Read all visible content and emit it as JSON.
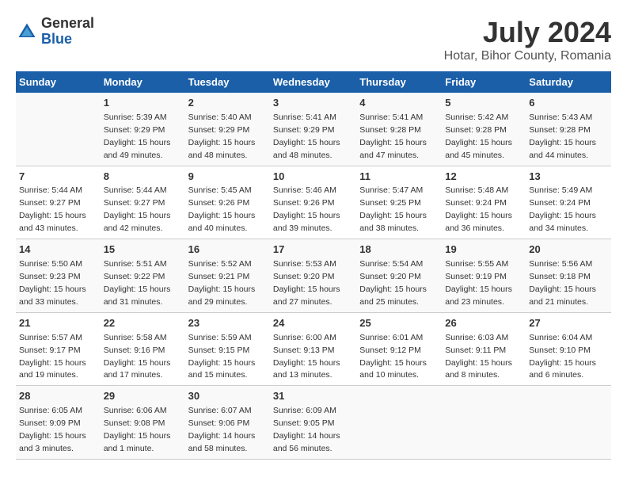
{
  "header": {
    "logo_general": "General",
    "logo_blue": "Blue",
    "title": "July 2024",
    "subtitle": "Hotar, Bihor County, Romania"
  },
  "calendar": {
    "headers": [
      "Sunday",
      "Monday",
      "Tuesday",
      "Wednesday",
      "Thursday",
      "Friday",
      "Saturday"
    ],
    "weeks": [
      [
        {
          "day": "",
          "info": ""
        },
        {
          "day": "1",
          "info": "Sunrise: 5:39 AM\nSunset: 9:29 PM\nDaylight: 15 hours\nand 49 minutes."
        },
        {
          "day": "2",
          "info": "Sunrise: 5:40 AM\nSunset: 9:29 PM\nDaylight: 15 hours\nand 48 minutes."
        },
        {
          "day": "3",
          "info": "Sunrise: 5:41 AM\nSunset: 9:29 PM\nDaylight: 15 hours\nand 48 minutes."
        },
        {
          "day": "4",
          "info": "Sunrise: 5:41 AM\nSunset: 9:28 PM\nDaylight: 15 hours\nand 47 minutes."
        },
        {
          "day": "5",
          "info": "Sunrise: 5:42 AM\nSunset: 9:28 PM\nDaylight: 15 hours\nand 45 minutes."
        },
        {
          "day": "6",
          "info": "Sunrise: 5:43 AM\nSunset: 9:28 PM\nDaylight: 15 hours\nand 44 minutes."
        }
      ],
      [
        {
          "day": "7",
          "info": "Sunrise: 5:44 AM\nSunset: 9:27 PM\nDaylight: 15 hours\nand 43 minutes."
        },
        {
          "day": "8",
          "info": "Sunrise: 5:44 AM\nSunset: 9:27 PM\nDaylight: 15 hours\nand 42 minutes."
        },
        {
          "day": "9",
          "info": "Sunrise: 5:45 AM\nSunset: 9:26 PM\nDaylight: 15 hours\nand 40 minutes."
        },
        {
          "day": "10",
          "info": "Sunrise: 5:46 AM\nSunset: 9:26 PM\nDaylight: 15 hours\nand 39 minutes."
        },
        {
          "day": "11",
          "info": "Sunrise: 5:47 AM\nSunset: 9:25 PM\nDaylight: 15 hours\nand 38 minutes."
        },
        {
          "day": "12",
          "info": "Sunrise: 5:48 AM\nSunset: 9:24 PM\nDaylight: 15 hours\nand 36 minutes."
        },
        {
          "day": "13",
          "info": "Sunrise: 5:49 AM\nSunset: 9:24 PM\nDaylight: 15 hours\nand 34 minutes."
        }
      ],
      [
        {
          "day": "14",
          "info": "Sunrise: 5:50 AM\nSunset: 9:23 PM\nDaylight: 15 hours\nand 33 minutes."
        },
        {
          "day": "15",
          "info": "Sunrise: 5:51 AM\nSunset: 9:22 PM\nDaylight: 15 hours\nand 31 minutes."
        },
        {
          "day": "16",
          "info": "Sunrise: 5:52 AM\nSunset: 9:21 PM\nDaylight: 15 hours\nand 29 minutes."
        },
        {
          "day": "17",
          "info": "Sunrise: 5:53 AM\nSunset: 9:20 PM\nDaylight: 15 hours\nand 27 minutes."
        },
        {
          "day": "18",
          "info": "Sunrise: 5:54 AM\nSunset: 9:20 PM\nDaylight: 15 hours\nand 25 minutes."
        },
        {
          "day": "19",
          "info": "Sunrise: 5:55 AM\nSunset: 9:19 PM\nDaylight: 15 hours\nand 23 minutes."
        },
        {
          "day": "20",
          "info": "Sunrise: 5:56 AM\nSunset: 9:18 PM\nDaylight: 15 hours\nand 21 minutes."
        }
      ],
      [
        {
          "day": "21",
          "info": "Sunrise: 5:57 AM\nSunset: 9:17 PM\nDaylight: 15 hours\nand 19 minutes."
        },
        {
          "day": "22",
          "info": "Sunrise: 5:58 AM\nSunset: 9:16 PM\nDaylight: 15 hours\nand 17 minutes."
        },
        {
          "day": "23",
          "info": "Sunrise: 5:59 AM\nSunset: 9:15 PM\nDaylight: 15 hours\nand 15 minutes."
        },
        {
          "day": "24",
          "info": "Sunrise: 6:00 AM\nSunset: 9:13 PM\nDaylight: 15 hours\nand 13 minutes."
        },
        {
          "day": "25",
          "info": "Sunrise: 6:01 AM\nSunset: 9:12 PM\nDaylight: 15 hours\nand 10 minutes."
        },
        {
          "day": "26",
          "info": "Sunrise: 6:03 AM\nSunset: 9:11 PM\nDaylight: 15 hours\nand 8 minutes."
        },
        {
          "day": "27",
          "info": "Sunrise: 6:04 AM\nSunset: 9:10 PM\nDaylight: 15 hours\nand 6 minutes."
        }
      ],
      [
        {
          "day": "28",
          "info": "Sunrise: 6:05 AM\nSunset: 9:09 PM\nDaylight: 15 hours\nand 3 minutes."
        },
        {
          "day": "29",
          "info": "Sunrise: 6:06 AM\nSunset: 9:08 PM\nDaylight: 15 hours\nand 1 minute."
        },
        {
          "day": "30",
          "info": "Sunrise: 6:07 AM\nSunset: 9:06 PM\nDaylight: 14 hours\nand 58 minutes."
        },
        {
          "day": "31",
          "info": "Sunrise: 6:09 AM\nSunset: 9:05 PM\nDaylight: 14 hours\nand 56 minutes."
        },
        {
          "day": "",
          "info": ""
        },
        {
          "day": "",
          "info": ""
        },
        {
          "day": "",
          "info": ""
        }
      ]
    ]
  }
}
